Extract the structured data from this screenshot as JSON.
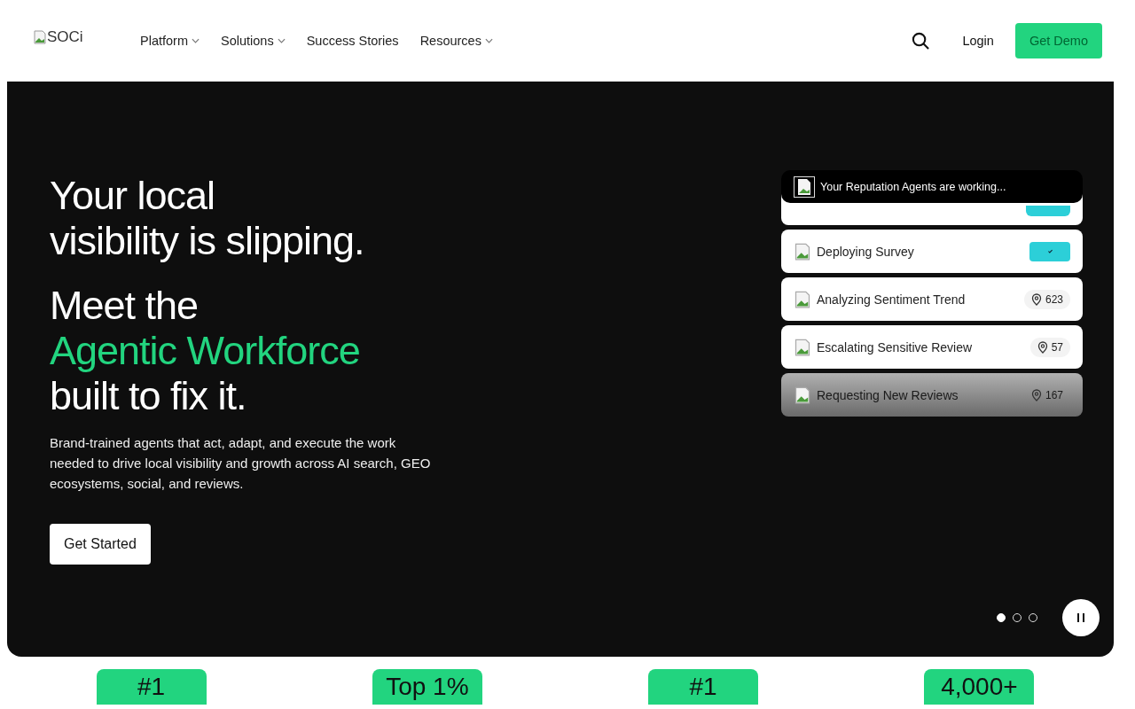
{
  "header": {
    "logo_alt": "SOCi",
    "nav": [
      {
        "label": "Platform",
        "dropdown": true
      },
      {
        "label": "Solutions",
        "dropdown": true
      },
      {
        "label": "Success Stories",
        "dropdown": false
      },
      {
        "label": "Resources",
        "dropdown": true
      }
    ],
    "login": "Login",
    "demo": "Get Demo"
  },
  "hero": {
    "headline": [
      "Your local",
      "visibility is slipping."
    ],
    "subline_1": "Meet the",
    "subline_accent": "Agentic Workforce",
    "subline_2": "built to fix it.",
    "body": "Brand-trained agents that act, adapt, and execute the work needed to drive local visibility and growth across AI search, GEO ecosystems, social, and reviews.",
    "cta": "Get Started",
    "agents": {
      "title": "Your Reputation Agents are working...",
      "items": [
        {
          "kind": "check",
          "label": "Deploying Survey",
          "faded": false
        },
        {
          "kind": "count",
          "label": "Analyzing Sentiment Trend",
          "count": "623",
          "faded": false
        },
        {
          "kind": "count",
          "label": "Escalating Sensitive Review",
          "count": "57",
          "faded": false
        },
        {
          "kind": "count",
          "label": "Requesting New Reviews",
          "count": "167",
          "faded": true
        }
      ]
    },
    "slides": [
      {
        "selected": true
      },
      {
        "selected": false
      },
      {
        "selected": false
      }
    ]
  },
  "stats": [
    "#1",
    "Top 1%",
    "#1",
    "4,000+"
  ]
}
